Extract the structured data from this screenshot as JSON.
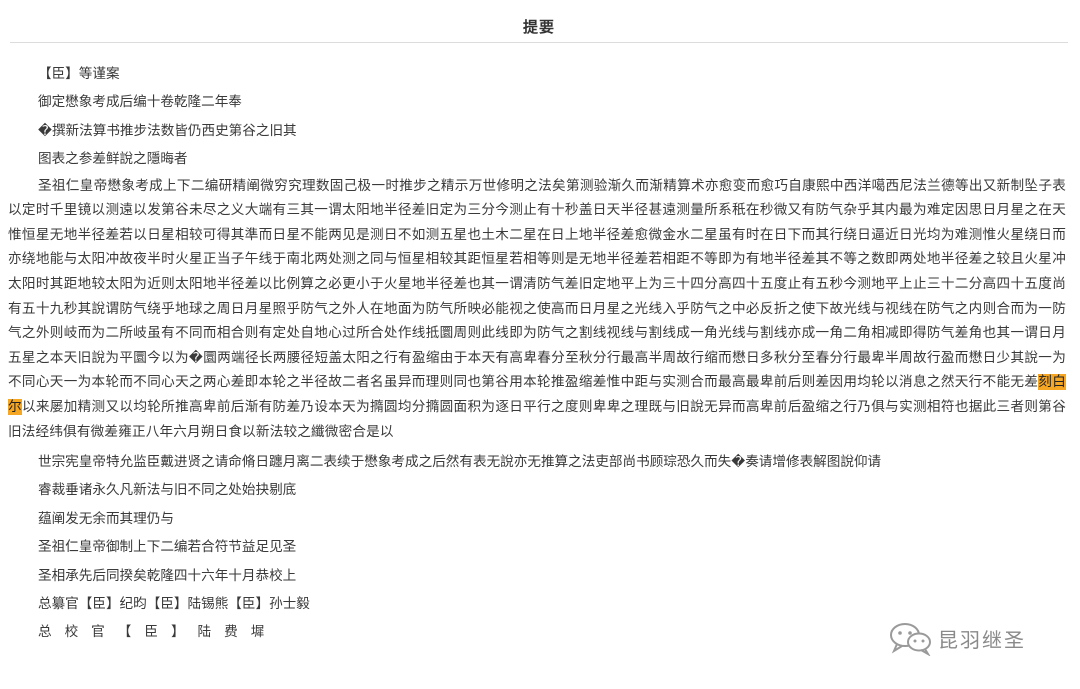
{
  "header": {
    "title": "提要"
  },
  "lines_top": [
    "【臣】等谨案",
    "御定懋象考成后编十卷乾隆二年奉",
    "�撰新法算书推步法数皆仍西史第谷之旧其",
    "图表之参差鲜說之隱晦者"
  ],
  "paragraph": {
    "before_highlight": "圣祖仁皇帝懋象考成上下二编研精阐微穷究理数固己极一时推步之精示万世修明之法矣第测验渐久而渐精算术亦愈变而愈巧自康熙中西洋噶西尼法兰德等出又新制坠子表以定时千里镜以测遠以发第谷未尽之义大端有三其一谓太阳地半径差旧定为三分今测止有十秒盖日天半径甚遠测量所系秖在秒微又有防气杂乎其内最为难定因思日月星之在天惟恒星无地半径差若以日星相较可得其準而日星不能两见是测日不如测五星也土木二星在日上地半径差愈微金水二星虽有时在日下而其行绕日逼近日光均为难测惟火星绕日而亦绕地能与太阳冲故夜半时火星正当子午线于南北两处测之同与恒星相较其距恒星若相等则是无地半径差若相距不等即为有地半径差其不等之数即两处地半径差之较且火星冲太阳时其距地较太阳为近则太阳地半径差以比例算之必更小于火星地半径差也其一谓清防气差旧定地平上为三十四分高四十五度止有五秒今测地平上止三十二分高四十五度尚有五十九秒其說谓防气绕乎地球之周日月星照乎防气之外人在地面为防气所映必能视之使高而日月星之光线入乎防气之中必反折之使下故光线与视线在防气之内则合而为一防气之外则岐而为二所岐虽有不同而相合则有定处自地心过所合处作线抵圜周则此线即为防气之割线视线与割线成一角光线与割线亦成一角二角相减即得防气差角也其一谓日月五星之本天旧說为平圜今以为�圜两端径长两腰径短盖太阳之行有盈缩由于本天有高卑春分至秋分行最高半周故行缩而懋日多秋分至春分行最卑半周故行盈而懋日少其說一为不同心天一为本轮而不同心天之两心差即本轮之半径故二者名虽异而理则同也第谷用本轮推盈缩差惟中距与实测合而最高最卑前后则差因用均轮以消息之然天行不能无差",
    "highlight": "刻白尔",
    "after_highlight": "以来屡加精测又以均轮所推高卑前后渐有防差乃设本天为撱圆均分撱圆面积为逐日平行之度则卑卑之理既与旧說无异而高卑前后盈缩之行乃俱与实测相符也据此三者则第谷旧法经纬俱有微差雍正八年六月朔日食以新法较之纖微密合是以"
  },
  "lines_bottom": [
    "世宗宪皇帝特允监臣戴进贤之请命脩日躔月离二表续于懋象考成之后然有表无說亦无推算之法吏部尚书顾琮恐久而失�奏请增修表解图說仰请",
    "睿裁垂诸永久凡新法与旧不同之处始抉剔底",
    "蕴阐发无余而其理仍与",
    "圣祖仁皇帝御制上下二编若合符节益足见圣",
    "圣相承先后同揆矣乾隆四十六年十月恭校上",
    "总纂官【臣】纪昀【臣】陆锡熊【臣】孙士毅",
    "总校官【臣】陆费墀"
  ],
  "watermark": {
    "text": "昆羽继圣",
    "icon": "wechat-icon"
  },
  "colors": {
    "highlight": "#f5a623",
    "text": "#3a3a3a",
    "title": "#333333"
  }
}
